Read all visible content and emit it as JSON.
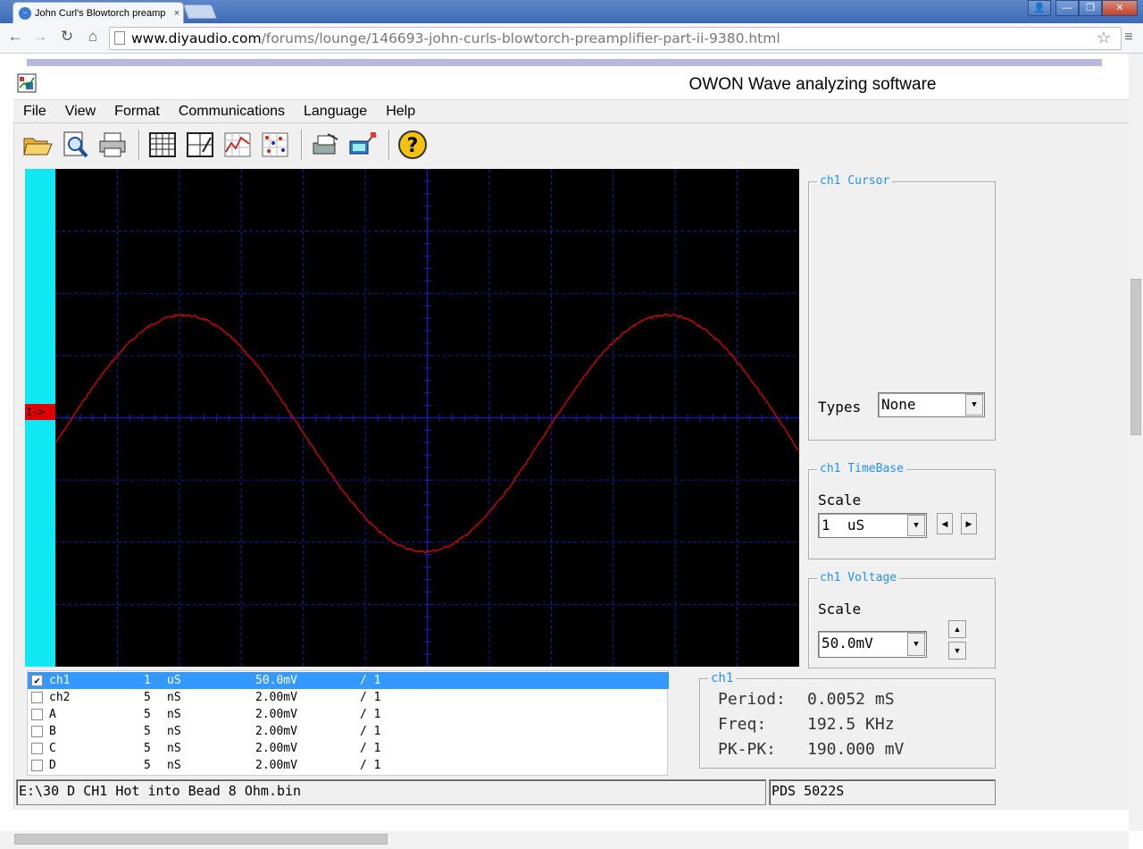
{
  "browser": {
    "tab_title": "John Curl's Blowtorch preamp",
    "tab_close": "×",
    "window_buttons": [
      "👤",
      "—",
      "❐",
      "✕"
    ],
    "nav": {
      "back": "←",
      "forward": "→",
      "reload": "↻",
      "home": "⌂"
    },
    "url_host": "www.diyaudio.com",
    "url_path": "/forums/lounge/146693-john-curls-blowtorch-preamplifier-part-ii-9380.html",
    "star": "☆",
    "menu": "≡"
  },
  "app": {
    "title": "OWON Wave analyzing software",
    "icon": "owon-app-icon",
    "menu": [
      "File",
      "View",
      "Format",
      "Communications",
      "Language",
      "Help"
    ],
    "toolbar_icons": [
      "open-folder-icon",
      "print-preview-icon",
      "print-icon",
      "table-icon",
      "grid-edit-icon",
      "waveform-chart-icon",
      "dot-chart-icon",
      "export-icon",
      "device-connect-icon",
      "help-icon"
    ]
  },
  "scope": {
    "channel_marker": "1->",
    "trace_color": "#e00000",
    "grid_color": "#1a1aa8",
    "background": "#000000",
    "trace": {
      "period_div": 7.8,
      "amplitude_div": 1.9,
      "offset_div": 0.25,
      "start_phase_deg": -5
    }
  },
  "cursor_panel": {
    "label": "ch1 Cursor",
    "types_label": "Types",
    "types_value": "None"
  },
  "timebase_panel": {
    "label": "ch1 TimeBase",
    "scale_label": "Scale",
    "scale_value": "1  uS"
  },
  "voltage_panel": {
    "label": "ch1 Voltage",
    "scale_label": "Scale",
    "scale_value": "50.0mV"
  },
  "channels": [
    {
      "checked": true,
      "name": "ch1",
      "time": "1",
      "unit": "uS",
      "volt": "50.0mV",
      "probe": "/ 1"
    },
    {
      "checked": false,
      "name": "ch2",
      "time": "5",
      "unit": "nS",
      "volt": "2.00mV",
      "probe": "/ 1"
    },
    {
      "checked": false,
      "name": "A",
      "time": "5",
      "unit": "nS",
      "volt": "2.00mV",
      "probe": "/ 1"
    },
    {
      "checked": false,
      "name": "B",
      "time": "5",
      "unit": "nS",
      "volt": "2.00mV",
      "probe": "/ 1"
    },
    {
      "checked": false,
      "name": "C",
      "time": "5",
      "unit": "nS",
      "volt": "2.00mV",
      "probe": "/ 1"
    },
    {
      "checked": false,
      "name": "D",
      "time": "5",
      "unit": "nS",
      "volt": "2.00mV",
      "probe": "/ 1"
    }
  ],
  "measurements": {
    "label": "ch1",
    "period_label": "Period:",
    "period_value": "0.0052 mS",
    "freq_label": "Freq:",
    "freq_value": "192.5 KHz",
    "pkpk_label": "PK-PK:",
    "pkpk_value": "190.000 mV"
  },
  "status": {
    "file": "E:\\30 D CH1 Hot into Bead 8 Ohm.bin",
    "device": "PDS 5022S"
  }
}
